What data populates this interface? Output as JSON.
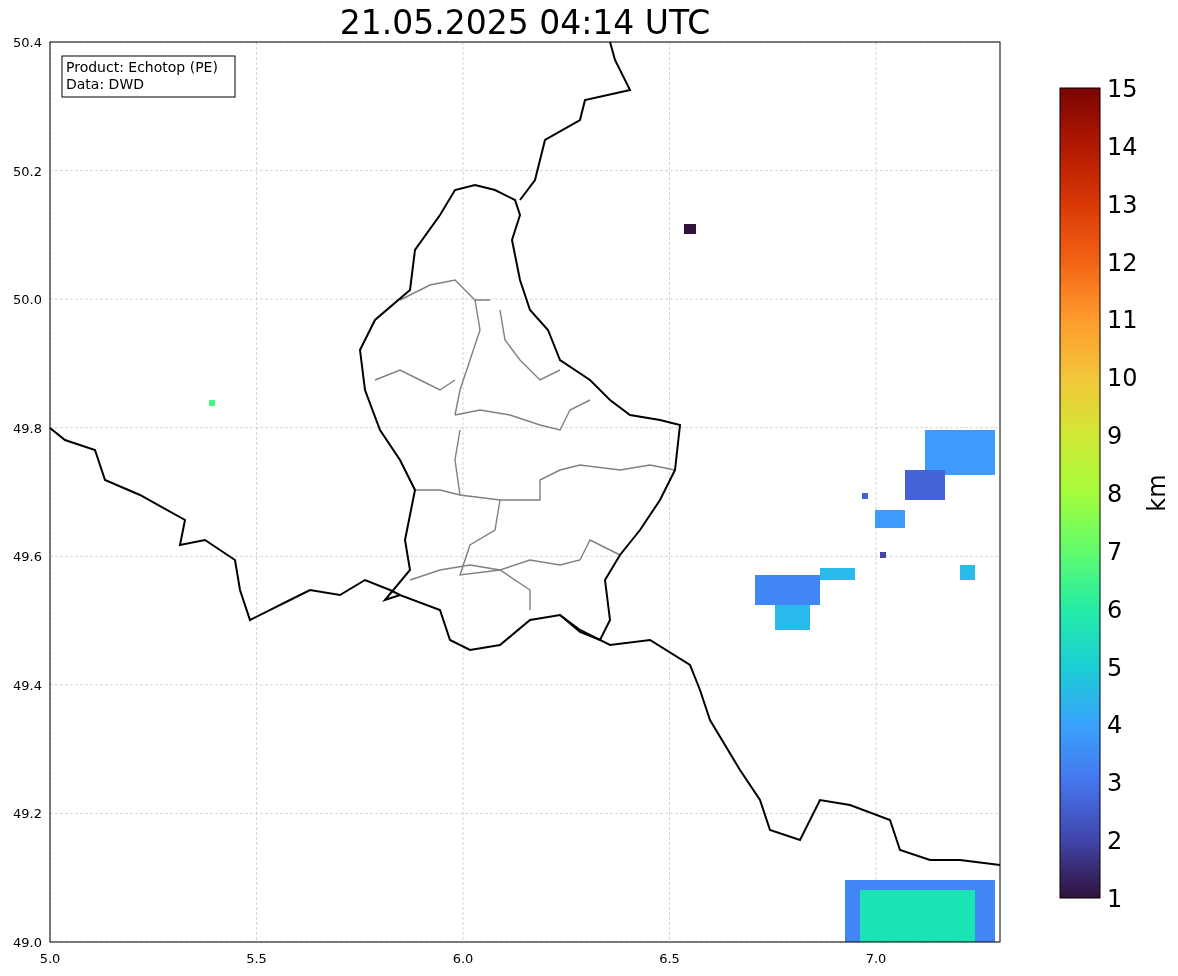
{
  "title": "21.05.2025 04:14 UTC",
  "info_box": {
    "lines": [
      "Product: Echotop (PE)",
      "Data: DWD"
    ]
  },
  "map": {
    "xticks": [
      "5.0",
      "5.5",
      "6.0",
      "6.5",
      "7.0"
    ],
    "yticks": [
      "50.4",
      "50.2",
      "50.0",
      "49.8",
      "49.6",
      "49.4",
      "49.2",
      "49.0"
    ]
  },
  "colorbar": {
    "label": "km",
    "ticks": [
      "15",
      "14",
      "13",
      "12",
      "11",
      "10",
      "9",
      "8",
      "7",
      "6",
      "5",
      "4",
      "3",
      "2",
      "1"
    ]
  }
}
